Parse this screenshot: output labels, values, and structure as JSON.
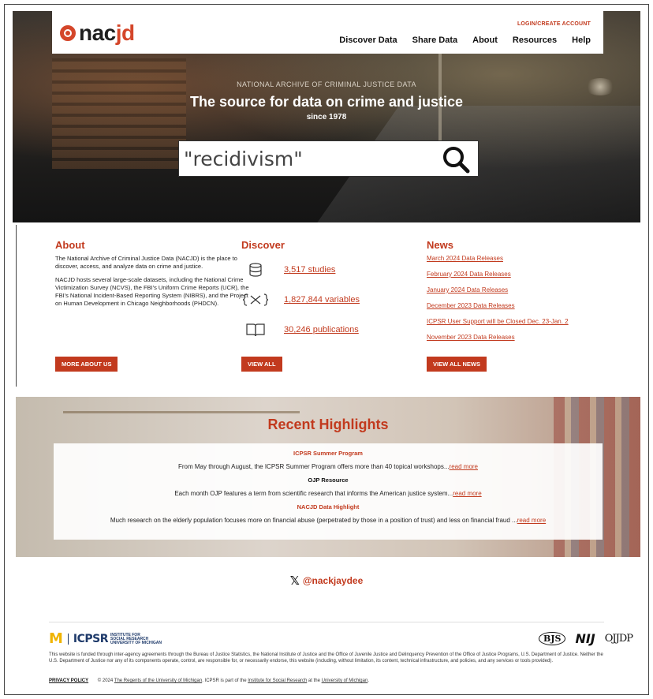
{
  "header": {
    "logo_prefix": "nac",
    "logo_suffix": "jd",
    "login": "LOGIN/CREATE ACCOUNT",
    "nav": [
      "Discover Data",
      "Share Data",
      "About",
      "Resources",
      "Help"
    ]
  },
  "hero": {
    "subtitle": "NATIONAL ARCHIVE OF CRIMINAL JUSTICE DATA",
    "title": "The source for data on crime and justice",
    "since": "since 1978",
    "search_value": "\"recidivism\""
  },
  "about": {
    "heading": "About",
    "p1": "The National Archive of Criminal Justice Data (NACJD) is the place to discover, access, and analyze data on crime and justice.",
    "p2": "NACJD hosts several large-scale datasets, including the National Crime Victimization Survey (NCVS), the FBI's Uniform Crime Reports (UCR), the FBI's National Incident-Based Reporting System (NIBRS), and the Project on Human Development in Chicago Neighborhoods (PHDCN).",
    "button": "MORE ABOUT US"
  },
  "discover": {
    "heading": "Discover",
    "items": [
      {
        "label": "3,517 studies",
        "icon": "database-icon"
      },
      {
        "label": "1,827,844 variables",
        "icon": "variable-icon"
      },
      {
        "label": "30,246 publications",
        "icon": "book-icon"
      }
    ],
    "button": "VIEW ALL"
  },
  "news": {
    "heading": "News",
    "items": [
      "March 2024 Data Releases",
      "February 2024 Data Releases",
      "January 2024 Data Releases",
      "December 2023 Data Releases",
      "ICPSR User Support will be Closed Dec. 23-Jan. 2",
      "November 2023 Data Releases"
    ],
    "button": "VIEW ALL NEWS"
  },
  "highlights": {
    "title": "Recent Highlights",
    "items": [
      {
        "heading": "ICPSR Summer Program",
        "text": "From May through August, the ICPSR Summer Program offers more than 40 topical workshops...",
        "link": "read more"
      },
      {
        "heading": "OJP Resource",
        "text": "Each month OJP features a term from scientific research that informs the American justice system...",
        "link": "read more"
      },
      {
        "heading": "NACJD Data Highlight",
        "text": "Much research on the elderly population focuses more on financial abuse (perpetrated by those in a position of trust) and less on financial fraud ...",
        "link": "read more"
      }
    ]
  },
  "twitter": {
    "handle": "@nackjaydee"
  },
  "footer": {
    "um": "M",
    "icpsr": "ICPSR",
    "isr_line1": "INSTITUTE FOR",
    "isr_line2": "SOCIAL RESEARCH",
    "isr_line3": "UNIVERSITY OF MICHIGAN",
    "bjs": "BJS",
    "nij": "NIJ",
    "ojjdp": "OJJDP",
    "funding": "This website is funded through inter-agency agreements through the Bureau of Justice Statistics, the National Institute of Justice and the Office of Juvenile Justice and Delinquency Prevention of the Office of Justice Programs, U.S. Department of Justice. Neither the U.S. Department of Justice nor any of its components operate, control, are responsible for, or necessarily endorse, this website (including, without limitation, its content, technical infrastructure, and policies, and any services or tools provided).",
    "privacy": "PRIVACY POLICY",
    "copy_prefix": "© 2024 ",
    "regents": "The Regents of the University of Michigan",
    "copy_mid": ". ICPSR is part of the ",
    "isr_link": "Institute for Social Research",
    "copy_at": " at the ",
    "um_link": "University of Michigan",
    "copy_end": "."
  }
}
